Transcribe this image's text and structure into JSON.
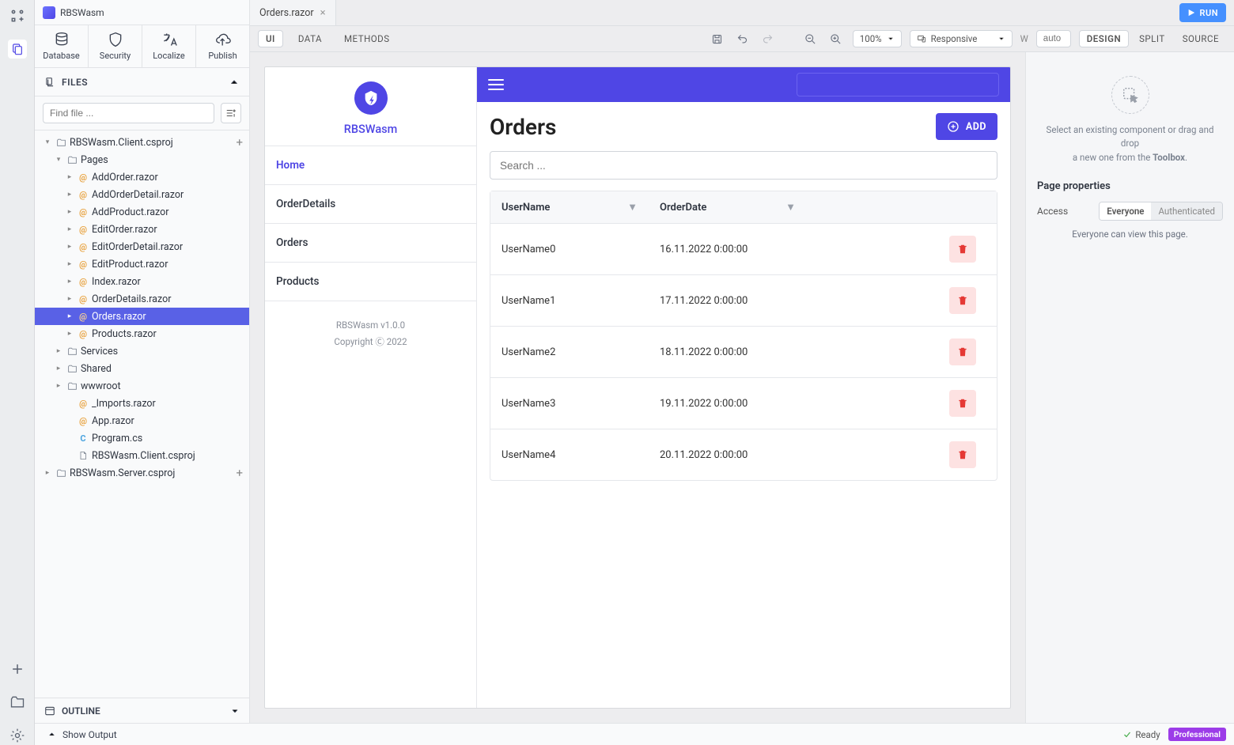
{
  "project_name": "RBSWasm",
  "toolbar": [
    {
      "icon": "database",
      "label": "Database"
    },
    {
      "icon": "security",
      "label": "Security"
    },
    {
      "icon": "localize",
      "label": "Localize"
    },
    {
      "icon": "publish",
      "label": "Publish"
    }
  ],
  "files_label": "FILES",
  "find_placeholder": "Find file ...",
  "tree": {
    "client": "RBSWasm.Client.csproj",
    "pages_folder": "Pages",
    "pages": [
      "AddOrder.razor",
      "AddOrderDetail.razor",
      "AddProduct.razor",
      "EditOrder.razor",
      "EditOrderDetail.razor",
      "EditProduct.razor",
      "Index.razor",
      "OrderDetails.razor",
      "Orders.razor",
      "Products.razor"
    ],
    "selected_index": 8,
    "services": "Services",
    "shared": "Shared",
    "wwwroot": "wwwroot",
    "imports": "_Imports.razor",
    "app": "App.razor",
    "program": "Program.cs",
    "csproj": "RBSWasm.Client.csproj",
    "server": "RBSWasm.Server.csproj"
  },
  "outline_label": "OUTLINE",
  "show_output": "Show Output",
  "open_tab": "Orders.razor",
  "run_label": "RUN",
  "mode_tabs": {
    "ui": "UI",
    "data": "DATA",
    "methods": "METHODS"
  },
  "zoom": "100%",
  "responsive": "Responsive",
  "w_label": "W",
  "w_value": "auto",
  "view_tabs": {
    "design": "DESIGN",
    "split": "SPLIT",
    "source": "SOURCE"
  },
  "preview": {
    "brand": "RBSWasm",
    "nav": [
      "Home",
      "OrderDetails",
      "Orders",
      "Products"
    ],
    "version": "RBSWasm v1.0.0",
    "copyright": "Copyright Ⓒ 2022",
    "title": "Orders",
    "add_label": "ADD",
    "search_placeholder": "Search ...",
    "columns": [
      "UserName",
      "OrderDate"
    ],
    "rows": [
      {
        "user": "UserName0",
        "date": "16.11.2022 0:00:00"
      },
      {
        "user": "UserName1",
        "date": "17.11.2022 0:00:00"
      },
      {
        "user": "UserName2",
        "date": "18.11.2022 0:00:00"
      },
      {
        "user": "UserName3",
        "date": "19.11.2022 0:00:00"
      },
      {
        "user": "UserName4",
        "date": "20.11.2022 0:00:00"
      }
    ]
  },
  "props": {
    "empty_text_a": "Select an existing component or drag and drop",
    "empty_text_b": "a new one from the ",
    "toolbox": "Toolbox",
    "header": "Page properties",
    "access_label": "Access",
    "everyone": "Everyone",
    "authenticated": "Authenticated",
    "note": "Everyone can view this page."
  },
  "status": {
    "ready": "Ready",
    "plan": "Professional"
  }
}
